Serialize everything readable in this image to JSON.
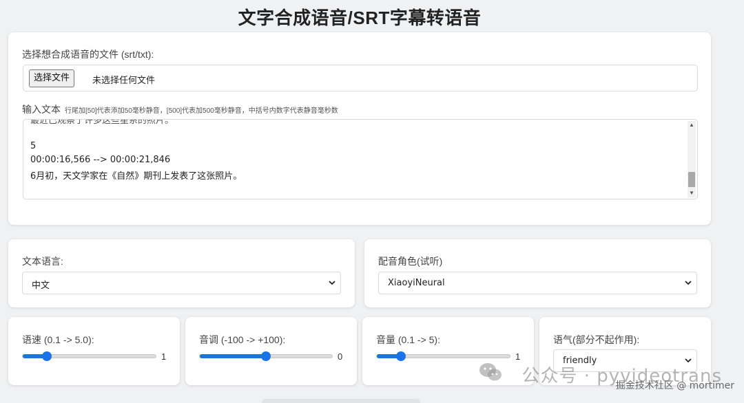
{
  "page": {
    "title": "文字合成语音/SRT字幕转语音"
  },
  "file_section": {
    "label": "选择想合成语音的文件 (srt/txt):",
    "button_label": "选择文件",
    "status": "未选择任何文件"
  },
  "text_section": {
    "label": "输入文本",
    "hint": "行尾加[50]代表添加50毫秒静音，[500]代表加500毫秒静音，中括号内数字代表静音毫秒数",
    "lines": [
      "最近已观察了许多这些星系的照片。",
      "",
      "5",
      "00:00:16,566 --> 00:00:21,846",
      "6月初，天文学家在《自然》期刊上发表了这张照片。"
    ]
  },
  "language": {
    "label": "文本语言:",
    "value": "中文"
  },
  "voice": {
    "label": "配音角色(试听)",
    "value": "XiaoyiNeural"
  },
  "rate": {
    "label": "语速 (0.1 -> 5.0):",
    "value": "1",
    "fraction": 0.18
  },
  "pitch": {
    "label": "音调 (-100 -> +100):",
    "value": "0",
    "fraction": 0.5
  },
  "volume": {
    "label": "音量 (0.1 -> 5):",
    "value": "1",
    "fraction": 0.18
  },
  "style": {
    "label": "语气(部分不起作用):",
    "value": "friendly"
  },
  "overlay": {
    "watermark": "公众号 · pyvideotrans",
    "credit": "掘金技术社区 @ mortimer"
  },
  "colors": {
    "accent": "#1a73e8",
    "background": "#f0f1f3"
  }
}
